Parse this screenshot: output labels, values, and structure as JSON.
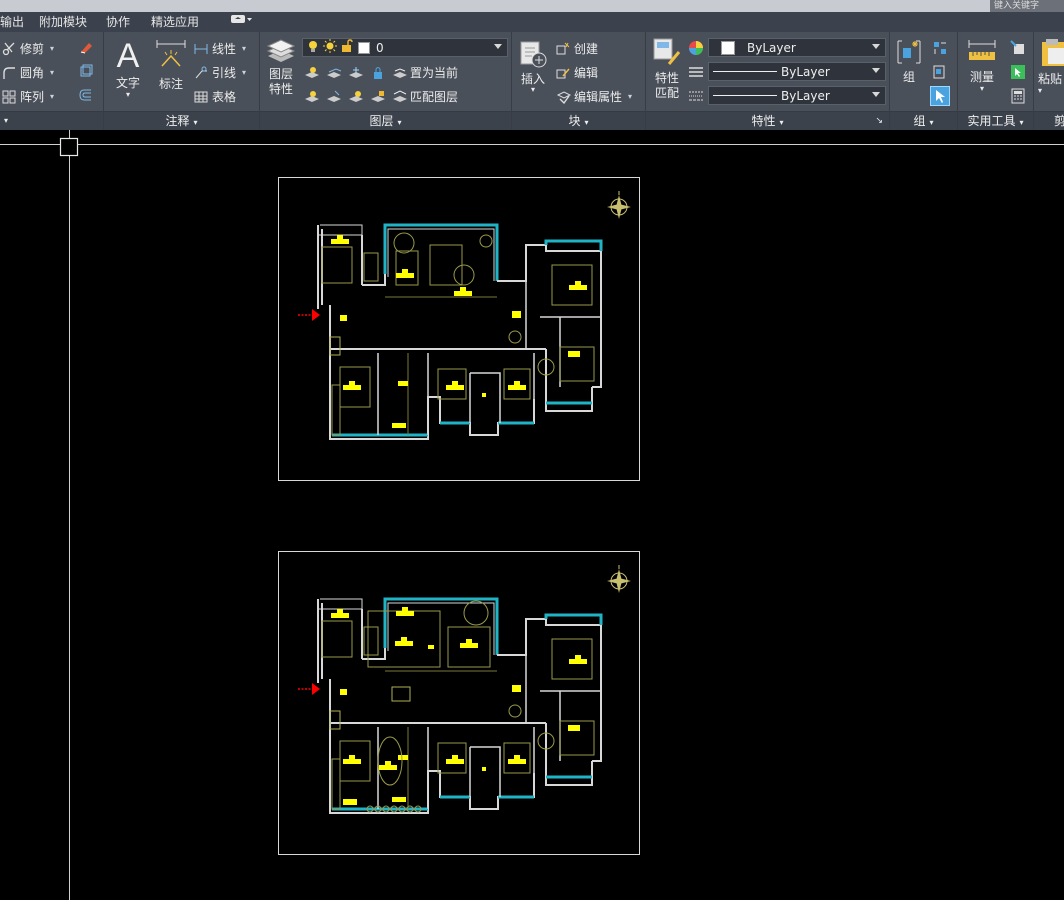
{
  "topstrip": {
    "ghost_text": "键入关键字"
  },
  "menubar": {
    "items": [
      "输出",
      "附加模块",
      "协作",
      "精选应用"
    ],
    "extra_icon": "cloud-icon"
  },
  "ribbon": {
    "modify": {
      "trim": "修剪",
      "fillet": "圆角",
      "array": "阵列"
    },
    "annotation": {
      "text": "文字",
      "dimension": "标注",
      "linear": "线性",
      "leader": "引线",
      "table": "表格",
      "footer": "注释"
    },
    "layers": {
      "layer_props_top": "图层",
      "layer_props_bottom": "特性",
      "current_layer": "0",
      "set_current": "置为当前",
      "match_layer": "匹配图层",
      "footer": "图层"
    },
    "block": {
      "insert": "插入",
      "create": "创建",
      "edit": "编辑",
      "edit_attributes": "编辑属性",
      "footer": "块"
    },
    "properties": {
      "match_top": "特性",
      "match_bottom": "匹配",
      "color": "ByLayer",
      "linetype": "ByLayer",
      "lineweight": "ByLayer",
      "footer": "特性"
    },
    "groups": {
      "group": "组",
      "footer": "组"
    },
    "utilities": {
      "measure": "测量",
      "footer": "实用工具"
    },
    "clipboard": {
      "paste": "粘贴",
      "footer": "剪"
    }
  },
  "colors": {
    "accent_blue": "#4aa3df",
    "ribbon_bg": "#4a505a",
    "canvas_bg": "#000000",
    "plan_wall": "#d8d8d8",
    "plan_cyan": "#1fb3c6",
    "plan_yellow": "#ffff00",
    "plan_olive": "#9a9a4a",
    "arrow_red": "#ff0000"
  },
  "canvas": {
    "sheets": [
      "floor-plan-upper",
      "floor-plan-lower"
    ]
  }
}
